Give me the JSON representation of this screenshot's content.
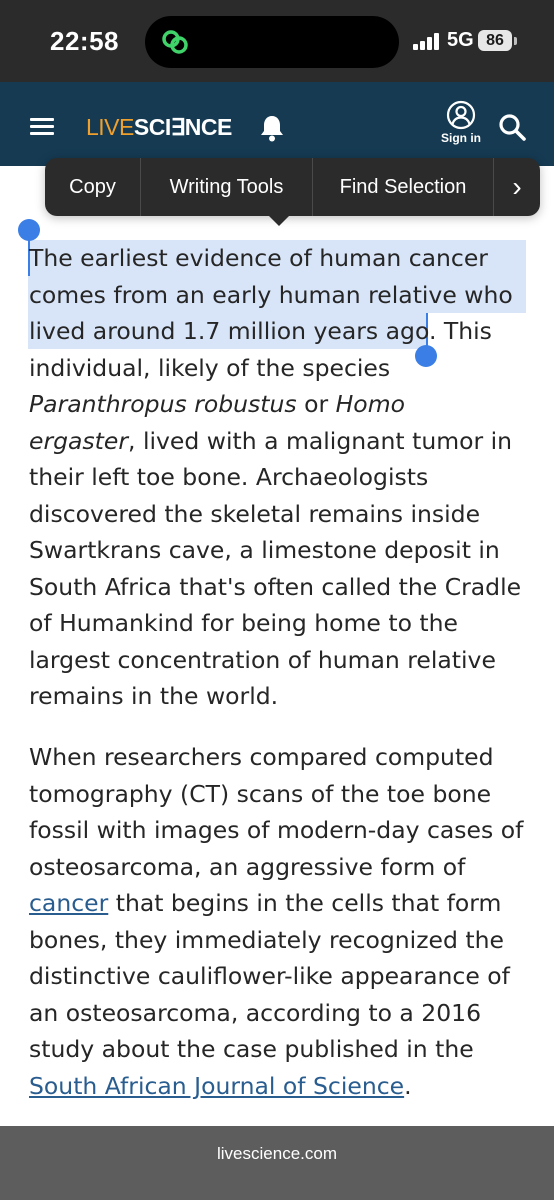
{
  "status_bar": {
    "time": "22:58",
    "network": "5G",
    "battery": "86"
  },
  "navbar": {
    "logo_live": "LIVE",
    "logo_science": "SCI∃NCE",
    "sign_in": "Sign in"
  },
  "context_menu": {
    "items": [
      "Copy",
      "Writing Tools",
      "Find Selection"
    ],
    "more": "›"
  },
  "article": {
    "p1_lines": [
      "The earliest evidence of human cancer",
      "comes from an early human relative who",
      "lived around 1.7 million years ago",
      ". This",
      "individual, likely of the species",
      "Paranthropus robustus",
      " or ",
      "Homo",
      "ergaster",
      ", lived with a malignant tumor in",
      "their left toe bone. Archaeologists",
      "discovered the skeletal remains inside",
      "Swartkrans cave, a limestone deposit in",
      "South Africa that's often called the Cradle",
      "of Humankind for being home to the",
      "largest concentration of human relative",
      "remains in the world."
    ],
    "p2_lines": [
      "When researchers compared computed",
      "tomography (CT) scans of the toe bone",
      "fossil with images of modern-day cases of",
      "osteosarcoma, an aggressive form of",
      "cancer",
      " that begins in the cells that form",
      "bones, they immediately recognized the",
      "distinctive cauliflower-like appearance of",
      "an osteosarcoma, according to a 2016",
      "study about the case published in the",
      "South African Journal of Science",
      "."
    ]
  },
  "url_bar": {
    "domain": "livescience.com"
  },
  "colors": {
    "nav_bg": "#153a52",
    "logo_accent": "#f0a02c",
    "selection": "#d8e5f8",
    "handle": "#3a7ee6",
    "link": "#2a5d8f"
  }
}
